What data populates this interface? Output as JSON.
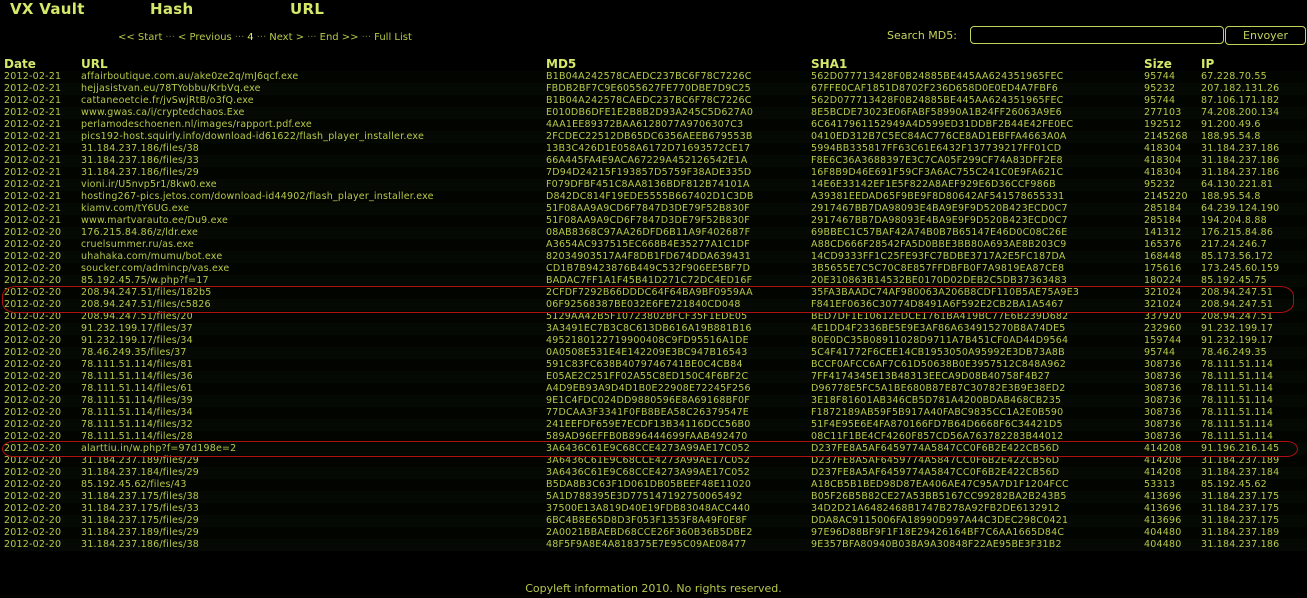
{
  "nav": {
    "vxvault": "VX Vault",
    "hash": "Hash",
    "url": "URL"
  },
  "pager": {
    "start": "<< Start",
    "previous": "< Previous",
    "current": "4",
    "next": "Next >",
    "end": "End >>",
    "fulllist": "Full List",
    "separator": "···"
  },
  "search": {
    "label": "Search MD5:",
    "value": "",
    "button": "Envoyer"
  },
  "columns": [
    "Date",
    "URL",
    "MD5",
    "SHA1",
    "Size",
    "IP"
  ],
  "rows": [
    [
      "2012-02-21",
      "affairboutique.com.au/ake0ze2q/mJ6qcf.exe",
      "B1B04A242578CAEDC237BC6F78C7226C",
      "562D077713428F0B24885BE445AA624351965FEC",
      "95744",
      "67.228.70.55"
    ],
    [
      "2012-02-21",
      "hejjasistvan.eu/78TYobbu/KrbVq.exe",
      "FBDB2BF7C9E6055627FE770DBE7D9C25",
      "67FFE0CAF1851D8702F236D658D0E0ED4A7FBF6",
      "95232",
      "207.182.131.26"
    ],
    [
      "2012-02-21",
      "cattaneoetcie.fr/jvSwjRtB/o3fQ.exe",
      "B1B04A242578CAEDC237BC6F78C7226C",
      "562D077713428F0B24885BE445AA624351965FEC",
      "95744",
      "87.106.171.182"
    ],
    [
      "2012-02-21",
      "www.gwas.ca/i/cryptedchaos.Exe",
      "E010DB6DFE1E2B8B2D93A245C5D627A0",
      "8E5BCDE73023E06FABF58990A1B24FF26063A9E6",
      "277103",
      "74.208.200.134"
    ],
    [
      "2012-02-21",
      "perlamodeschoenen.nl/images/rapport.pdf.exe",
      "4AA1EE89372BAA6128077A9706307C3",
      "6C6417961152949A4D599ED31DDBF2B44E42FE0EC",
      "192512",
      "91.200.49.6"
    ],
    [
      "2012-02-21",
      "pics192-host.squirly.info/download-id61622/flash_player_installer.exe",
      "2FCDEC22512DB65DC6356AEEB679553B",
      "0410ED312B7C5EC84AC776CE8AD1EBFFA4663A0A",
      "2145268",
      "188.95.54.8"
    ],
    [
      "2012-02-21",
      "31.184.237.186/files/38",
      "13B3C426D1E058A6172D71693572CE17",
      "5994BB335817FF63C61E6432F137739217FF01CD",
      "418304",
      "31.184.237.186"
    ],
    [
      "2012-02-21",
      "31.184.237.186/files/33",
      "66A445FA4E9ACA67229A452126542E1A",
      "F8E6C36A3688397E3C7CA05F299CF74A83DFF2E8",
      "418304",
      "31.184.237.186"
    ],
    [
      "2012-02-21",
      "31.184.237.186/files/29",
      "7D94D24215F193857D5759F38ADE335D",
      "16F8B9D46E691F59CF3A6AC755C241C0E9FA621C",
      "418304",
      "31.184.237.186"
    ],
    [
      "2012-02-21",
      "vioni.ir/U5nvp5r1/8kw0.exe",
      "F079DFBF451C8AA8136BDF812B74101A",
      "14E6E33142EF1E5F822A8AEF929E6D36CCF986B",
      "95232",
      "64.130.221.81"
    ],
    [
      "2012-02-21",
      "hosting267-pics.jetos.com/download-id44902/flash_player_installer.exe",
      "D842DC814F19EDE5555B667402D1C3DB",
      "A39381EEDAD65F9BE9F8D80642AF541578655331",
      "2145220",
      "188.95.54.8"
    ],
    [
      "2012-02-21",
      "kiamv.com/tY6UG.exe",
      "51F08AA9A9CD6F7847D3DE79F52B830F",
      "2917467BB7DA98093E4BA9E9F9D520B423ECD0C7",
      "285184",
      "64.239.124.190"
    ],
    [
      "2012-02-21",
      "www.martvarauto.ee/Du9.exe",
      "51F08AA9A9CD6F7847D3DE79F52B830F",
      "2917467BB7DA98093E4BA9E9F9D520B423ECD0C7",
      "285184",
      "194.204.8.88"
    ],
    [
      "2012-02-20",
      "176.215.84.86/z/ldr.exe",
      "08AB8368C97AA26DFD6B11A9F402687F",
      "69BBEC1C57BAF42A74B0B7B65147E46D0C08C26E",
      "141312",
      "176.215.84.86"
    ],
    [
      "2012-02-20",
      "cruelsummer.ru/as.exe",
      "A3654AC937515EC668B4E35277A1C1DF",
      "A88CD666F28542FA5D0BBE3BB80A693AE8B203C9",
      "165376",
      "217.24.246.7"
    ],
    [
      "2012-02-20",
      "uhahaka.com/mumu/bot.exe",
      "82034903517A4F8DB1FD674DDA639431",
      "14CD9333FF1C25FE93FC7BDBE3717A2E5FC187DA",
      "168448",
      "85.173.56.172"
    ],
    [
      "2012-02-20",
      "soucker.com/admincp/vas.exe",
      "CD1B7B9423876B449C532F906EE5BF7D",
      "3B5655E7C5C70C8E857FFDBFB0F7A9819EA87CE8",
      "175616",
      "173.245.60.159"
    ],
    [
      "2012-02-20",
      "85.192.45.75/w.php?f=17",
      "BADAC7FF1A1F45B41D271C72DC4ED16F",
      "20E310863B14532BE0170D02DEB2C5DB37363483",
      "180224",
      "85.192.45.75"
    ],
    [
      "2012-02-20",
      "208.94.247.51/files/182b5",
      "2CFDF7292B66DDDC64F64BA9BF0959AA",
      "35FA3BAADC74AF980063A206B8CDF110B5AE75A9E3",
      "321024",
      "208.94.247.51"
    ],
    [
      "2012-02-20",
      "208.94.247.51/files/c5826",
      "06F92568387BE032E6FE721840CD048",
      "F841EF0636C30774D8491A6F592E2CB2BA1A5467",
      "321024",
      "208.94.247.51"
    ],
    [
      "2012-02-20",
      "208.94.247.51/files/20",
      "5129AA42B5F10723802BFCF35F1EDE05",
      "BED7DF1E10612EDCE1761BA419BC77E6B239D682",
      "337920",
      "208.94.247.51"
    ],
    [
      "2012-02-20",
      "91.232.199.17/files/37",
      "3A3491EC7B3C8C613DB616A19B881B16",
      "4E1DD4F2336BE5E9E3AF86A634915270B8A74DE5",
      "232960",
      "91.232.199.17"
    ],
    [
      "2012-02-20",
      "91.232.199.17/files/34",
      "4952180122719900408C9FD95516A1DE",
      "80E0DC35B08911028D9711A7B451CF0AD44D9564",
      "159744",
      "91.232.199.17"
    ],
    [
      "2012-02-20",
      "78.46.249.35/files/37",
      "0A0508E531E4E142209E3BC947B16543",
      "5C4F41772F6CEE14CB1953050A95992E3DB73A8B",
      "95744",
      "78.46.249.35"
    ],
    [
      "2012-02-20",
      "78.111.51.114/files/81",
      "591C83FC638B4079746741BE0C4CB84",
      "BCCF0AFCC6AF7C61D50638B0E3957512C848A962",
      "308736",
      "78.111.51.114"
    ],
    [
      "2012-02-20",
      "78.111.51.114/files/36",
      "E05AE2C251FF02A55C8ED150C4F6BF2C",
      "7FF4174345E13B48313EECA9D08B40758F4B27",
      "308736",
      "78.111.51.114"
    ],
    [
      "2012-02-20",
      "78.111.51.114/files/61",
      "A4D9EB93A9D4D1B0E22908E72245F256",
      "D96778E5FC5A1BE680B87E87C30782E3B9E38ED2",
      "308736",
      "78.111.51.114"
    ],
    [
      "2012-02-20",
      "78.111.51.114/files/39",
      "9E1C4FDC024DD9880596E8A69168BF0F",
      "3E18F81601AB346CB5D781A4200BDAB468CB235",
      "308736",
      "78.111.51.114"
    ],
    [
      "2012-02-20",
      "78.111.51.114/files/34",
      "77DCAA3F3341F0FB8BEA58C26379547E",
      "F1872189AB59F5B917A40FABC9835CC1A2E0B590",
      "308736",
      "78.111.51.114"
    ],
    [
      "2012-02-20",
      "78.111.51.114/files/32",
      "241EEFDF659E7ECDF13B34116DCC56B0",
      "51F4E95E6E4FA870166FD7B64D6668F6C34421D5",
      "308736",
      "78.111.51.114"
    ],
    [
      "2012-02-20",
      "78.111.51.114/files/28",
      "589AD96EFFB0B896444699FAAB492470",
      "08C11F1BE4CF4260F857CD56A763782283B44012",
      "308736",
      "78.111.51.114"
    ],
    [
      "2012-02-20",
      "alarttiu.in/w.php?f=97d198e=2",
      "3A6436C61E9C68CCE4273A99AE17C052",
      "D237FE8A5AF6459774A5847CC0F6B2E422CB56D",
      "414208",
      "91.196.216.145"
    ],
    [
      "2012-02-20",
      "31.184.237.189/files/29",
      "3A6436C61E9C68CCE4273A99AE17C052",
      "D237FE8A5AF6459774A5847CC0F6B2E422CB56D",
      "414208",
      "31.184.237.189"
    ],
    [
      "2012-02-20",
      "31.184.237.184/files/29",
      "3A6436C61E9C68CCE4273A99AE17C052",
      "D237FE8A5AF6459774A5847CC0F6B2E422CB56D",
      "414208",
      "31.184.237.184"
    ],
    [
      "2012-02-20",
      "85.192.45.62/files/43",
      "B5DA8B3C63F1D061DB05BEEF48E11020",
      "A18CB5B1BED98D87EA406AE47C95A7D1F1204FCC",
      "53313",
      "85.192.45.62"
    ],
    [
      "2012-02-20",
      "31.184.237.175/files/38",
      "5A1D788395E3D775147192750065492",
      "B05F26B5B82CE27A53BB5167CC99282BA2B243B5",
      "413696",
      "31.184.237.175"
    ],
    [
      "2012-02-20",
      "31.184.237.175/files/33",
      "37500E13A819D40E19FDB83048ACC440",
      "34D2D21A6482468B1747B278A92FB2DE6132912",
      "413696",
      "31.184.237.175"
    ],
    [
      "2012-02-20",
      "31.184.237.175/files/29",
      "6BC4B8E65D8D3F053F1353F8A49F0E8F",
      "DDA8AC9115006FA18990D997A44C3DEC298C0421",
      "413696",
      "31.184.237.175"
    ],
    [
      "2012-02-20",
      "31.184.237.189/files/29",
      "2A0021BBAEBD68CCE26F360B36B5DBE2",
      "97E96D88BF9F1F18E29426164BF7C6AA1665D84C",
      "404480",
      "31.184.237.189"
    ],
    [
      "2012-02-20",
      "31.184.237.186/files/38",
      "48F5F9A8E4A818375E7E95C09AE08477",
      "9E357BFA80940B038A9A30848F22AE95BE3F31B2",
      "404480",
      "31.184.237.186"
    ]
  ],
  "highlight_color": "#b01010",
  "footer": "Copyleft information 2010. No rights reserved."
}
